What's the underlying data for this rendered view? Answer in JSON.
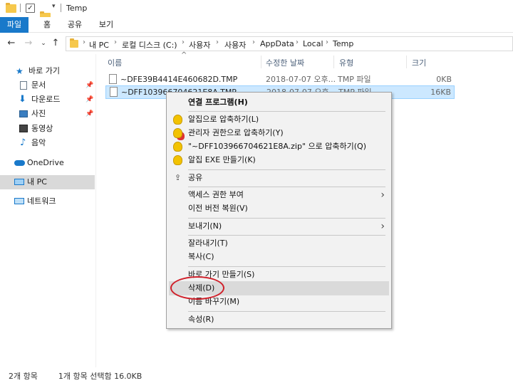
{
  "window": {
    "title": "Temp"
  },
  "ribbon": {
    "tabs": [
      "파일",
      "홈",
      "공유",
      "보기"
    ]
  },
  "address": {
    "crumbs": [
      "내 PC",
      "로컬 디스크 (C:)",
      "사용자",
      "사용자",
      "AppData",
      "Local",
      "Temp"
    ]
  },
  "sidebar": {
    "items": [
      {
        "label": "바로 가기",
        "icon": "star-icon"
      },
      {
        "label": "문서",
        "icon": "document-icon"
      },
      {
        "label": "다운로드",
        "icon": "download-icon"
      },
      {
        "label": "사진",
        "icon": "picture-icon"
      },
      {
        "label": "동영상",
        "icon": "video-icon"
      },
      {
        "label": "음악",
        "icon": "music-icon"
      },
      {
        "label": "OneDrive",
        "icon": "cloud-icon"
      },
      {
        "label": "내 PC",
        "icon": "computer-icon"
      },
      {
        "label": "네트워크",
        "icon": "network-icon"
      }
    ]
  },
  "columns": {
    "name": "이름",
    "date": "수정한 날짜",
    "type": "유형",
    "size": "크기"
  },
  "files": [
    {
      "name": "~DFE39B4414E460682D.TMP",
      "date": "2018-07-07 오후...",
      "type": "TMP 파일",
      "size": "0KB"
    },
    {
      "name": "~DFF103966704621E8A.TMP",
      "date": "2018-07-07 오후...",
      "type": "TMP 파일",
      "size": "16KB"
    }
  ],
  "context_menu": {
    "items": [
      {
        "label": "연결 프로그램(H)"
      },
      {
        "label": "알집으로 압축하기(L)"
      },
      {
        "label": "관리자 권한으로 압축하기(Y)"
      },
      {
        "label": "\"~DFF103966704621E8A.zip\" 으로 압축하기(Q)"
      },
      {
        "label": "알집 EXE 만들기(K)"
      },
      {
        "label": "공유"
      },
      {
        "label": "액세스 권한 부여"
      },
      {
        "label": "이전 버전 복원(V)"
      },
      {
        "label": "보내기(N)"
      },
      {
        "label": "잘라내기(T)"
      },
      {
        "label": "복사(C)"
      },
      {
        "label": "바로 가기 만들기(S)"
      },
      {
        "label": "삭제(D)"
      },
      {
        "label": "이름 바꾸기(M)"
      },
      {
        "label": "속성(R)"
      }
    ]
  },
  "status": {
    "count": "2개 항목",
    "selection": "1개 항목 선택함 16.0KB"
  },
  "colors": {
    "accent": "#1979ca",
    "selection": "#cce8ff",
    "annotation": "#d0202a"
  }
}
